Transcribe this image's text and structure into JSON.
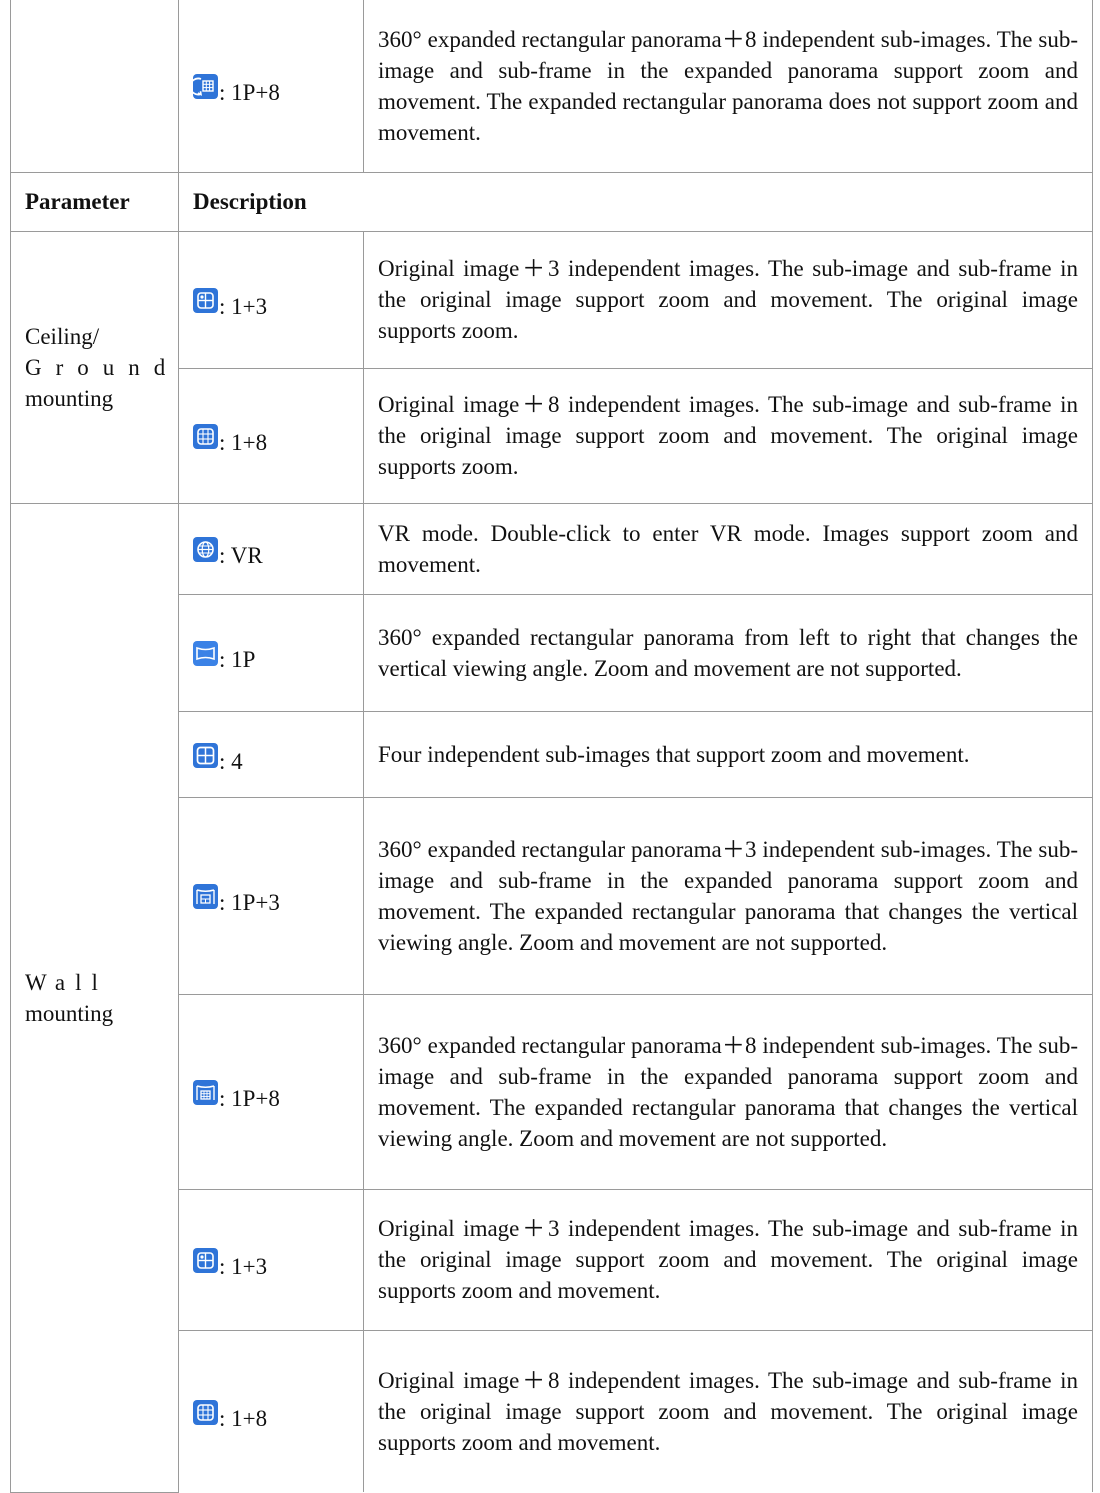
{
  "header": {
    "parameter": "Parameter",
    "description": "Description"
  },
  "top_row": {
    "icon": "panorama-8-icon",
    "mode": ": 1P+8",
    "description": "360° expanded rectangular panorama＋8 independent sub-images. The sub-image and sub-frame in the expanded panorama support zoom and movement. The expanded rectangular panorama does not support zoom and movement."
  },
  "ceiling_group": {
    "param_line1": "Ceiling/",
    "param_line2": "Ground",
    "param_line3": "mounting",
    "rows": [
      {
        "icon": "original-3-icon",
        "mode": ": 1+3",
        "description": "Original image＋3 independent images. The sub-image and sub-frame in the original image support zoom and movement. The original image supports zoom."
      },
      {
        "icon": "original-8-icon",
        "mode": ": 1+8",
        "description": "Original image＋8 independent images. The sub-image and sub-frame in the original image support zoom and movement. The original image supports zoom."
      }
    ]
  },
  "wall_group": {
    "param_line1": "Wall",
    "param_line2": "mounting",
    "rows": [
      {
        "icon": "vr-globe-icon",
        "mode": ": VR",
        "description": "VR mode. Double-click to enter VR mode. Images support zoom and movement."
      },
      {
        "icon": "panorama-1p-icon",
        "mode": ": 1P",
        "description": "360° expanded rectangular panorama from left to right that changes the vertical viewing angle. Zoom and movement are not supported."
      },
      {
        "icon": "quad-split-icon",
        "mode": ": 4",
        "description": "Four independent sub-images that support zoom and movement."
      },
      {
        "icon": "panorama-3-icon",
        "mode": ": 1P+3",
        "description": "360° expanded rectangular panorama＋3 independent sub-images. The sub-image and sub-frame in the expanded panorama support zoom and movement. The expanded rectangular panorama that changes the vertical viewing angle. Zoom and movement are not supported."
      },
      {
        "icon": "panorama-8-wall-icon",
        "mode": ": 1P+8",
        "description": "360° expanded rectangular panorama＋8 independent sub-images. The sub-image and sub-frame in the expanded panorama support zoom and movement. The expanded rectangular panorama that changes the vertical viewing angle. Zoom and movement are not supported."
      },
      {
        "icon": "original-3-icon",
        "mode": ": 1+3",
        "description": "Original image＋3 independent images. The sub-image and sub-frame in the original image support zoom and movement. The original image supports zoom and movement."
      },
      {
        "icon": "original-8-icon",
        "mode": ": 1+8",
        "description": "Original image＋8 independent images. The sub-image and sub-frame in the original image support zoom and movement. The original image supports zoom and movement."
      }
    ]
  },
  "colors": {
    "icon_blue": "#2f74d8",
    "border": "#9a9a9a"
  }
}
